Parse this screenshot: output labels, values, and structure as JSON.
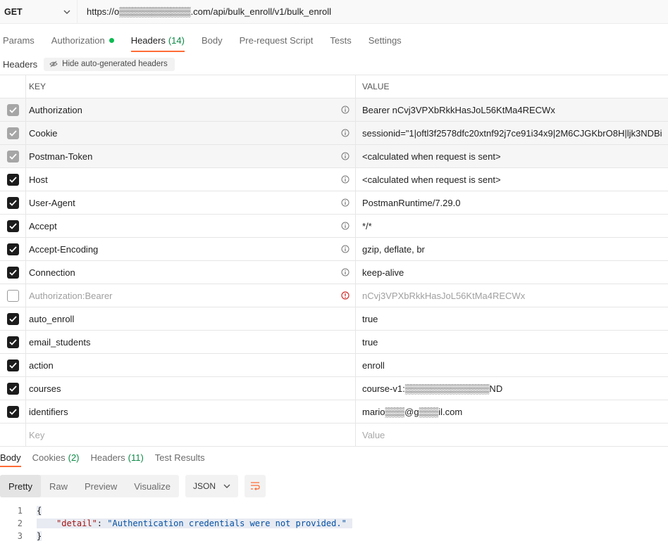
{
  "request": {
    "method": "GET",
    "url": "https://o▒▒▒▒▒▒▒▒▒▒▒.com/api/bulk_enroll/v1/bulk_enroll"
  },
  "request_tabs": [
    {
      "label": "Params",
      "count": ""
    },
    {
      "label": "Authorization",
      "count": ""
    },
    {
      "label": "Headers",
      "count": "(14)"
    },
    {
      "label": "Body",
      "count": ""
    },
    {
      "label": "Pre-request Script",
      "count": ""
    },
    {
      "label": "Tests",
      "count": ""
    },
    {
      "label": "Settings",
      "count": ""
    }
  ],
  "headers_section": {
    "label": "Headers",
    "hide_button": "Hide auto-generated headers"
  },
  "table": {
    "key_header": "KEY",
    "value_header": "VALUE",
    "rows": [
      {
        "key": "Authorization",
        "value": "Bearer nCvj3VPXbRkkHasJoL56KtMa4RECWx"
      },
      {
        "key": "Cookie",
        "value": "sessionid=\"1|oftl3f2578dfc20xtnf92j7ce91i34x9|2M6CJGKbrO8H|ljk3NDBi"
      },
      {
        "key": "Postman-Token",
        "value": "<calculated when request is sent>"
      },
      {
        "key": "Host",
        "value": "<calculated when request is sent>"
      },
      {
        "key": "User-Agent",
        "value": "PostmanRuntime/7.29.0"
      },
      {
        "key": "Accept",
        "value": "*/*"
      },
      {
        "key": "Accept-Encoding",
        "value": "gzip, deflate, br"
      },
      {
        "key": "Connection",
        "value": "keep-alive"
      },
      {
        "key": "Authorization:Bearer",
        "value": "nCvj3VPXbRkkHasJoL56KtMa4RECWx"
      },
      {
        "key": "auto_enroll",
        "value": "true"
      },
      {
        "key": "email_students",
        "value": "true"
      },
      {
        "key": "action",
        "value": "enroll"
      },
      {
        "key": "courses",
        "value": "course-v1:▒▒▒▒▒▒▒▒▒▒▒▒▒ND"
      },
      {
        "key": "identifiers",
        "value": "mario▒▒▒@g▒▒▒il.com"
      }
    ],
    "new_key_placeholder": "Key",
    "new_value_placeholder": "Value"
  },
  "response_tabs": [
    {
      "label": "Body",
      "count": ""
    },
    {
      "label": "Cookies",
      "count": "(2)"
    },
    {
      "label": "Headers",
      "count": "(11)"
    },
    {
      "label": "Test Results",
      "count": ""
    }
  ],
  "body_toolbar": {
    "views": [
      "Pretty",
      "Raw",
      "Preview",
      "Visualize"
    ],
    "format": "JSON"
  },
  "code": {
    "line_numbers": [
      "1",
      "2",
      "3"
    ],
    "open_brace": "{",
    "json_key": "\"detail\"",
    "colon": ": ",
    "json_value": "\"Authentication credentials were not provided.\"",
    "close_brace": "}"
  },
  "colors": {
    "accent_orange": "#ff6c37",
    "status_green": "#0cbb52",
    "error_red": "#d0312d"
  }
}
